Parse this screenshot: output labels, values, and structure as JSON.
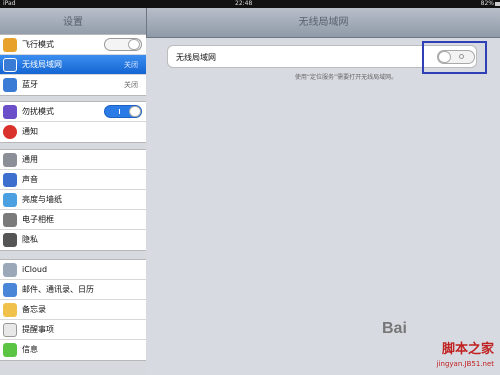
{
  "status_bar": {
    "device": "iPad",
    "time": "22:48",
    "battery": "82%"
  },
  "sidebar": {
    "title": "设置",
    "items": [
      {
        "label": "飞行模式",
        "control": "switch",
        "on": false,
        "icon": "airplane-icon",
        "color": "#e8a12a"
      },
      {
        "label": "无线局域网",
        "value": "关闭",
        "selected": true,
        "icon": "wifi-icon",
        "color": "#3a7bd5"
      },
      {
        "label": "蓝牙",
        "value": "关闭",
        "icon": "bluetooth-icon",
        "color": "#3a7bd5"
      },
      {
        "label": "勿扰模式",
        "control": "switch",
        "on": true,
        "icon": "moon-icon",
        "color": "#6b4fc8"
      },
      {
        "label": "通知",
        "icon": "notification-icon",
        "color": "#d9312b"
      },
      {
        "label": "通用",
        "icon": "gear-icon",
        "color": "#8a8f98"
      },
      {
        "label": "声音",
        "icon": "speaker-icon",
        "color": "#3d6fcf"
      },
      {
        "label": "亮度与墙纸",
        "icon": "brightness-icon",
        "color": "#4aa0e0"
      },
      {
        "label": "电子相框",
        "icon": "photo-frame-icon",
        "color": "#7a7a7a"
      },
      {
        "label": "隐私",
        "icon": "hand-icon",
        "color": "#555"
      },
      {
        "label": "iCloud",
        "icon": "cloud-icon",
        "color": "#9aa8b8"
      },
      {
        "label": "邮件、通讯录、日历",
        "icon": "mail-icon",
        "color": "#4a86d8"
      },
      {
        "label": "备忘录",
        "icon": "notes-icon",
        "color": "#f0c14b"
      },
      {
        "label": "提醒事项",
        "icon": "reminders-icon",
        "color": "#e8e8e8"
      },
      {
        "label": "信息",
        "icon": "messages-icon",
        "color": "#5cc443"
      }
    ]
  },
  "detail": {
    "title": "无线局域网",
    "wifi_label": "无线局域网",
    "wifi_on": false,
    "hint": "使用“定位服务”需要打开无线局域网。"
  },
  "watermark": {
    "baidu": "Bai",
    "site": "脚本之家",
    "url": "jingyan.JB51.net"
  }
}
